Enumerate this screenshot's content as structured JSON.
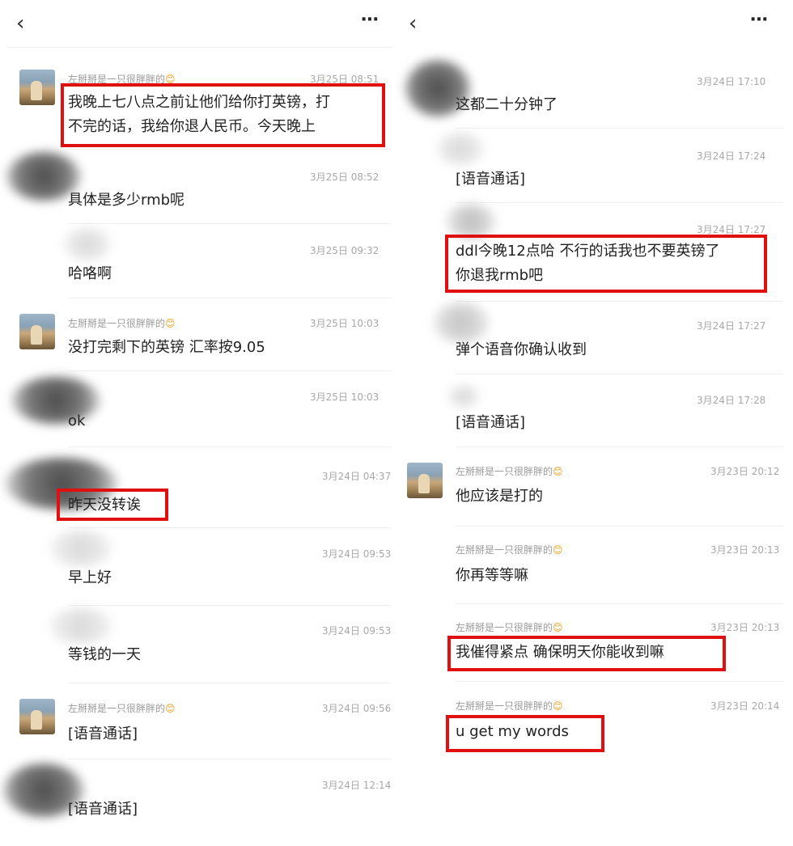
{
  "left": {
    "back_icon": "chevron-left-icon",
    "more_icon": "ellipsis-icon",
    "messages": [
      {
        "sender": "左掰掰是一只很胖胖的",
        "time": "3月25日 08:51",
        "lines": [
          "我晚上七八点之前让他们给你打英镑，打",
          "不完的话，我给你退人民币。今天晚上"
        ]
      },
      {
        "sender": "",
        "time": "3月25日 08:52",
        "lines": [
          "具体是多少rmb呢"
        ]
      },
      {
        "sender": "",
        "time": "3月25日 09:32",
        "lines": [
          "哈咯啊"
        ]
      },
      {
        "sender": "左掰掰是一只很胖胖的",
        "time": "3月25日 10:03",
        "lines": [
          "没打完剩下的英镑 汇率按9.05"
        ]
      },
      {
        "sender": "",
        "time": "3月25日 10:03",
        "lines": [
          "ok"
        ]
      },
      {
        "sender": "",
        "time": "3月24日 04:37",
        "lines": [
          "昨天没转诶"
        ]
      },
      {
        "sender": "",
        "time": "3月24日 09:53",
        "lines": [
          "早上好"
        ]
      },
      {
        "sender": "",
        "time": "3月24日 09:53",
        "lines": [
          "等钱的一天"
        ]
      },
      {
        "sender": "左掰掰是一只很胖胖的",
        "time": "3月24日 09:56",
        "lines": [
          "[语音通话]"
        ]
      },
      {
        "sender": "",
        "time": "3月24日 12:14",
        "lines": [
          "[语音通话]"
        ]
      }
    ]
  },
  "right": {
    "back_icon": "chevron-left-icon",
    "more_icon": "ellipsis-icon",
    "messages": [
      {
        "sender": "",
        "time": "3月24日 17:10",
        "lines": [
          "这都二十分钟了"
        ]
      },
      {
        "sender": "",
        "time": "3月24日 17:24",
        "lines": [
          "[语音通话]"
        ]
      },
      {
        "sender": "",
        "time": "3月24日 17:27",
        "lines": [
          "ddl今晚12点哈 不行的话我也不要英镑了",
          "你退我rmb吧"
        ]
      },
      {
        "sender": "",
        "time": "3月24日 17:27",
        "lines": [
          "弹个语音你确认收到"
        ]
      },
      {
        "sender": "",
        "time": "3月24日 17:28",
        "lines": [
          "[语音通话]"
        ]
      },
      {
        "sender": "左掰掰是一只很胖胖的",
        "time": "3月23日 20:12",
        "lines": [
          "他应该是打的"
        ]
      },
      {
        "sender": "左掰掰是一只很胖胖的",
        "time": "3月23日 20:13",
        "lines": [
          "你再等等嘛"
        ]
      },
      {
        "sender": "左掰掰是一只很胖胖的",
        "time": "3月23日 20:13",
        "lines": [
          "我催得紧点 确保明天你能收到嘛"
        ]
      },
      {
        "sender": "左掰掰是一只很胖胖的",
        "time": "3月23日 20:14",
        "lines": [
          "u get my words"
        ]
      }
    ]
  },
  "colors": {
    "highlight": "#e01010",
    "sender": "#9a9a9a",
    "time": "#a8a8a8",
    "text": "#222222"
  }
}
